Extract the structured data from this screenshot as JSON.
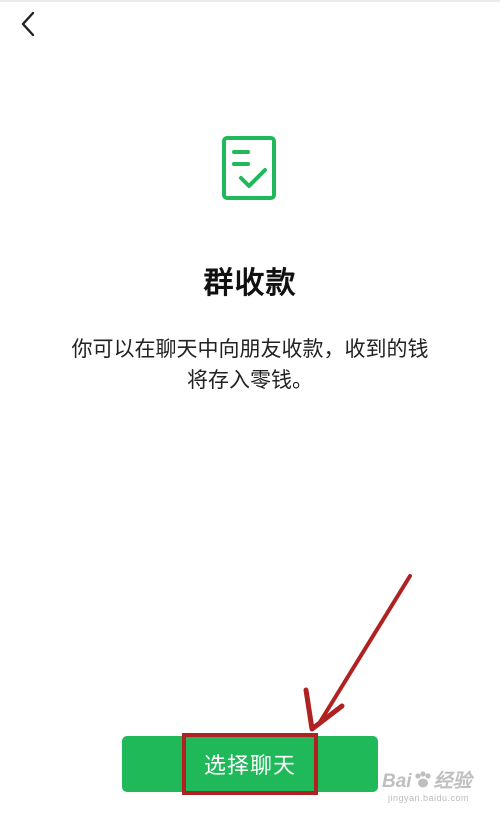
{
  "header": {
    "back_icon": "chevron-left-icon"
  },
  "hero": {
    "icon": "document-check-icon",
    "title": "群收款",
    "description_lines": [
      "你可以在聊天中向朋友收款，收到的钱",
      "将存入零钱。"
    ]
  },
  "action": {
    "button_label": "选择聊天"
  },
  "annotation": {
    "highlight_color": "#b02222",
    "arrow_color": "#b02222"
  },
  "watermark": {
    "brand": "Bai",
    "brand_cn": "经验",
    "url": "jingyan.baidu.com"
  },
  "colors": {
    "accent": "#1fb95a",
    "background": "#ffffff",
    "text": "#111111"
  }
}
